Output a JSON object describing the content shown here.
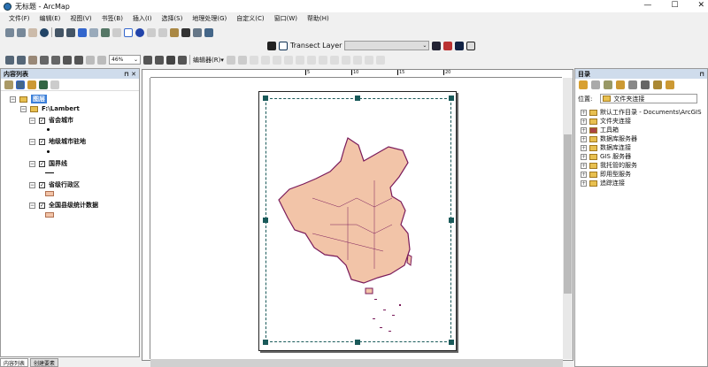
{
  "window": {
    "title": "无标题 - ArcMap"
  },
  "menu": [
    "文件(F)",
    "编辑(E)",
    "视图(V)",
    "书签(B)",
    "插入(I)",
    "选择(S)",
    "地理处理(G)",
    "自定义(C)",
    "窗口(W)",
    "帮助(H)"
  ],
  "toolbar": {
    "transect_label": "Transect Layer",
    "transect_value": "",
    "zoom_value": "46%",
    "editor_label": "编辑器(R)▾"
  },
  "toc": {
    "title": "内容列表",
    "root": "图层",
    "folder": "F:\\Lambert",
    "layers": [
      {
        "name": "省会城市",
        "symbol": "point"
      },
      {
        "name": "地级城市驻地",
        "symbol": "point"
      },
      {
        "name": "国界线",
        "symbol": "line"
      },
      {
        "name": "省级行政区",
        "symbol": "polygon"
      },
      {
        "name": "全国县级统计数据",
        "symbol": "polygon"
      }
    ],
    "tabs": [
      "内容列表",
      "创建要素"
    ]
  },
  "ruler": {
    "ticks": [
      "5",
      "10",
      "15",
      "20"
    ]
  },
  "catalog": {
    "title": "目录",
    "location_label": "位置:",
    "location_value": "文件夹连接",
    "items": [
      "默认工作目录 - Documents\\ArcGIS",
      "文件夹连接",
      "工具箱",
      "数据库服务器",
      "数据库连接",
      "GIS 服务器",
      "我托管的服务",
      "即用型服务",
      "追踪连接"
    ]
  },
  "colors": {
    "map_fill": "#f2c4a8",
    "map_outline": "#7a1a5a",
    "panel_header": "#cfdcec"
  }
}
